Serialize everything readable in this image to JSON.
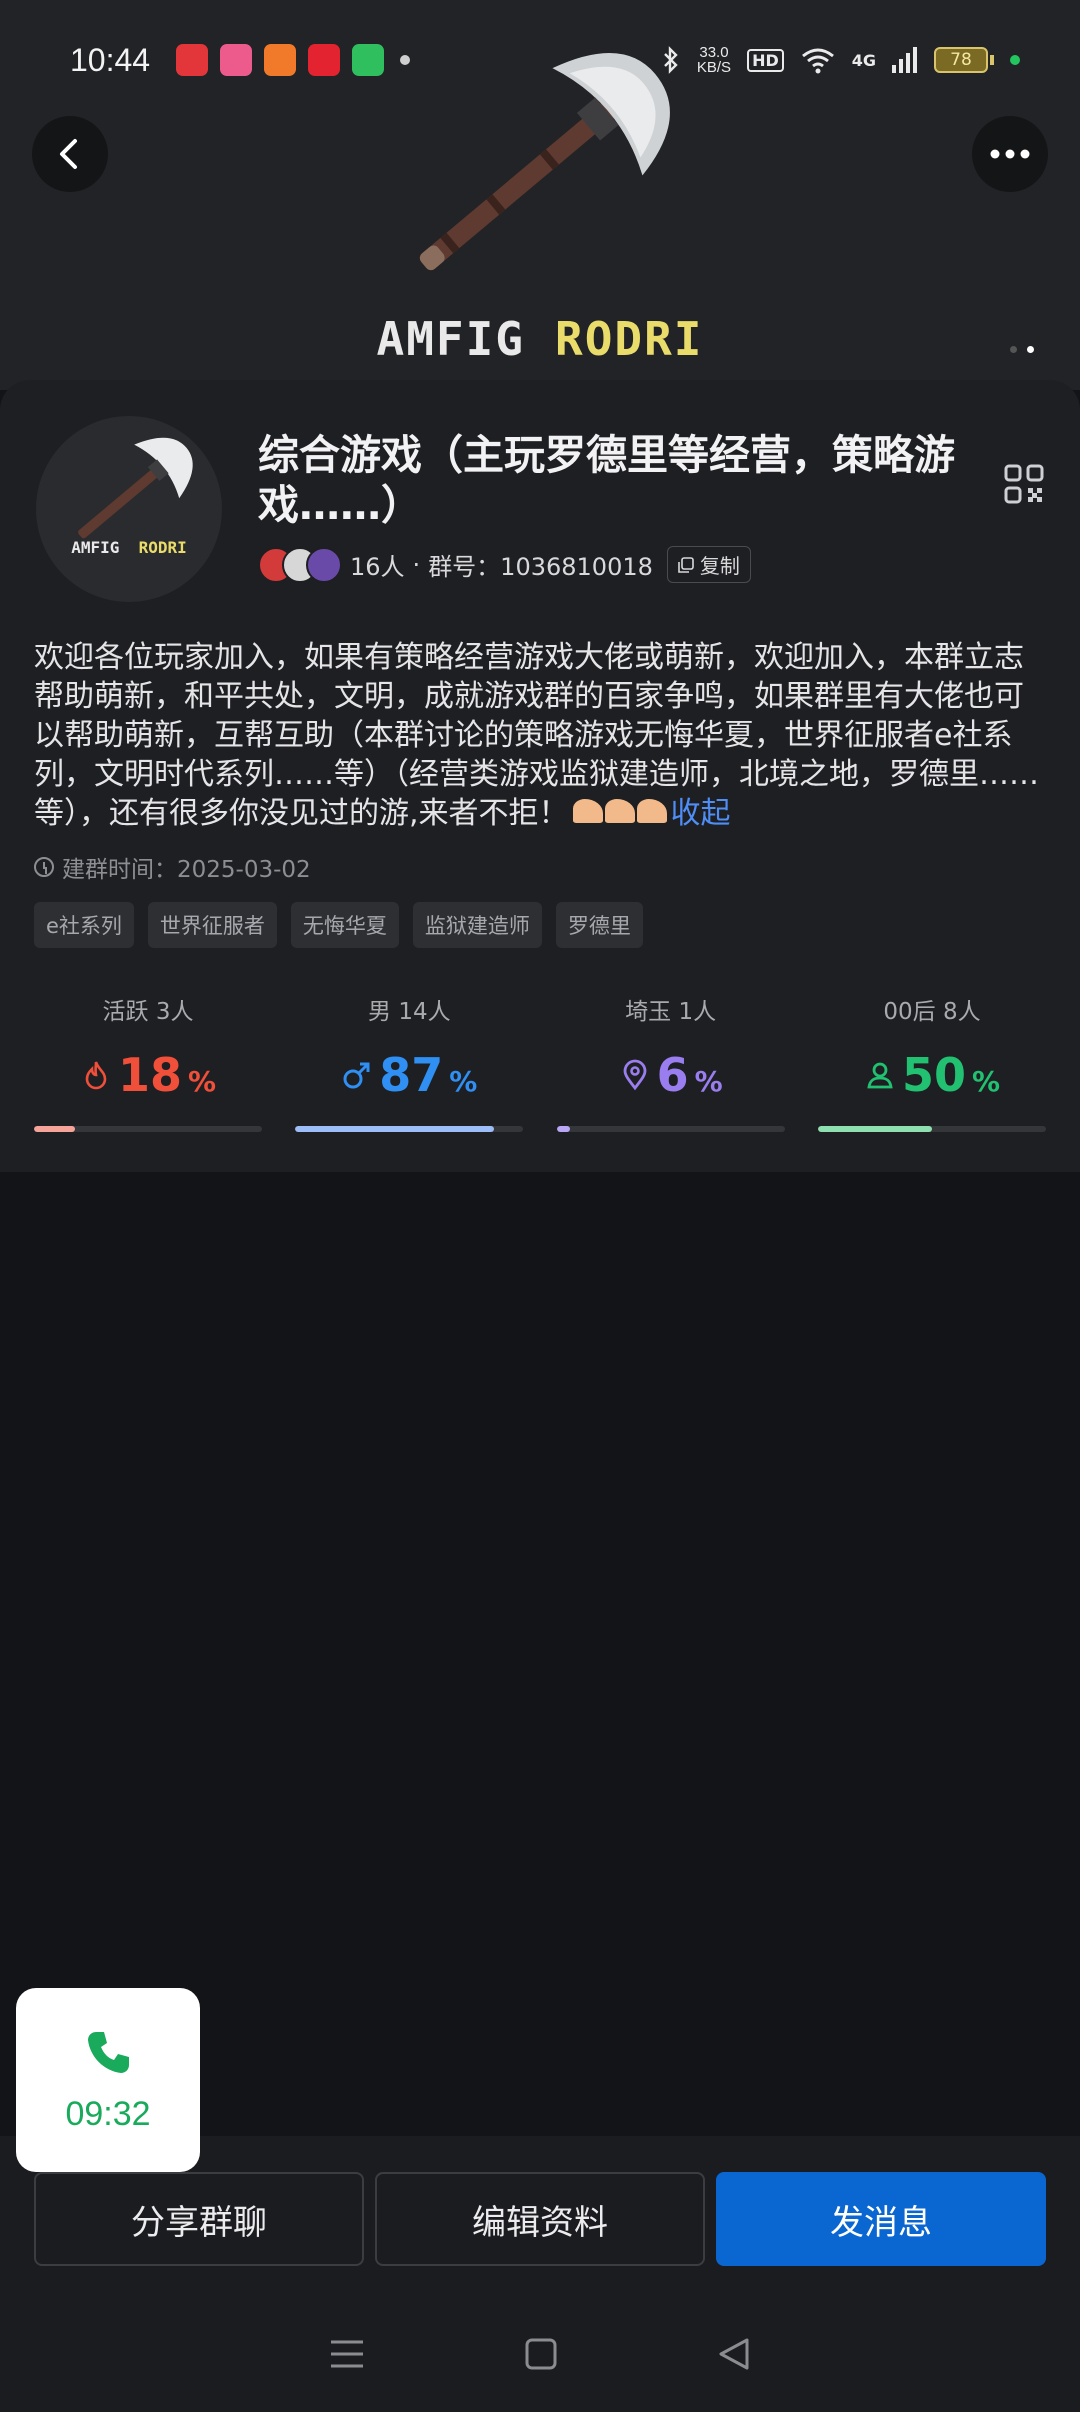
{
  "status_bar": {
    "time": "10:44",
    "net_speed": "33.0",
    "net_unit": "KB/S",
    "hd": "HD",
    "signal": "4G",
    "battery": "78",
    "app_icon_colors": [
      "#e2363b",
      "#ec5b8c",
      "#f07a2a",
      "#e3232f",
      "#2fbf5f"
    ]
  },
  "hero": {
    "title_white": "AMFIG",
    "title_yellow": "RODRI",
    "back_icon": "chevron-left-icon",
    "more_icon": "more-horizontal-icon"
  },
  "group": {
    "name": "综合游戏（主玩罗德里等经营，策略游戏……）",
    "member_count": "16人",
    "separator": "·",
    "id_text": "群号：1036810018",
    "copy_label": "复制",
    "description": "欢迎各位玩家加入，如果有策略经营游戏大佬或萌新，欢迎加入，本群立志帮助萌新，和平共处，文明，成就游戏群的百家争鸣，如果群里有大佬也可以帮助萌新，互帮互助（本群讨论的策略游戏无悔华夏，世界征服者e社系列，文明时代系列……等）（经营类游戏监狱建造师，北境之地，罗德里……等），还有很多你没见过的游,来者不拒！",
    "collapse_label": "收起",
    "created_text": "建群时间：2025-03-02",
    "tags": [
      "e社系列",
      "世界征服者",
      "无悔华夏",
      "监狱建造师",
      "罗德里"
    ]
  },
  "stats": [
    {
      "label": "活跃 3人",
      "value": "18",
      "unit": "%",
      "fraction": 0.18,
      "color": "#f04f3a",
      "bar_color": "#f6a39a",
      "icon": "flame-icon"
    },
    {
      "label": "男 14人",
      "value": "87",
      "unit": "%",
      "fraction": 0.87,
      "color": "#2f8ff2",
      "bar_color": "#9cbdf8",
      "icon": "male-icon"
    },
    {
      "label": "埼玉 1人",
      "value": "6",
      "unit": "%",
      "fraction": 0.06,
      "color": "#9a7ef0",
      "bar_color": "#b9a7f5",
      "icon": "location-pin-icon"
    },
    {
      "label": "00后 8人",
      "value": "50",
      "unit": "%",
      "fraction": 0.5,
      "color": "#22c172",
      "bar_color": "#8fe0b0",
      "icon": "person-icon"
    }
  ],
  "call": {
    "time": "09:32",
    "icon": "phone-icon"
  },
  "actions": {
    "share": "分享群聊",
    "edit": "编辑资料",
    "send": "发消息"
  },
  "nav": {
    "menu_icon": "menu-icon",
    "home_icon": "home-square-icon",
    "back_icon": "back-triangle-icon"
  }
}
